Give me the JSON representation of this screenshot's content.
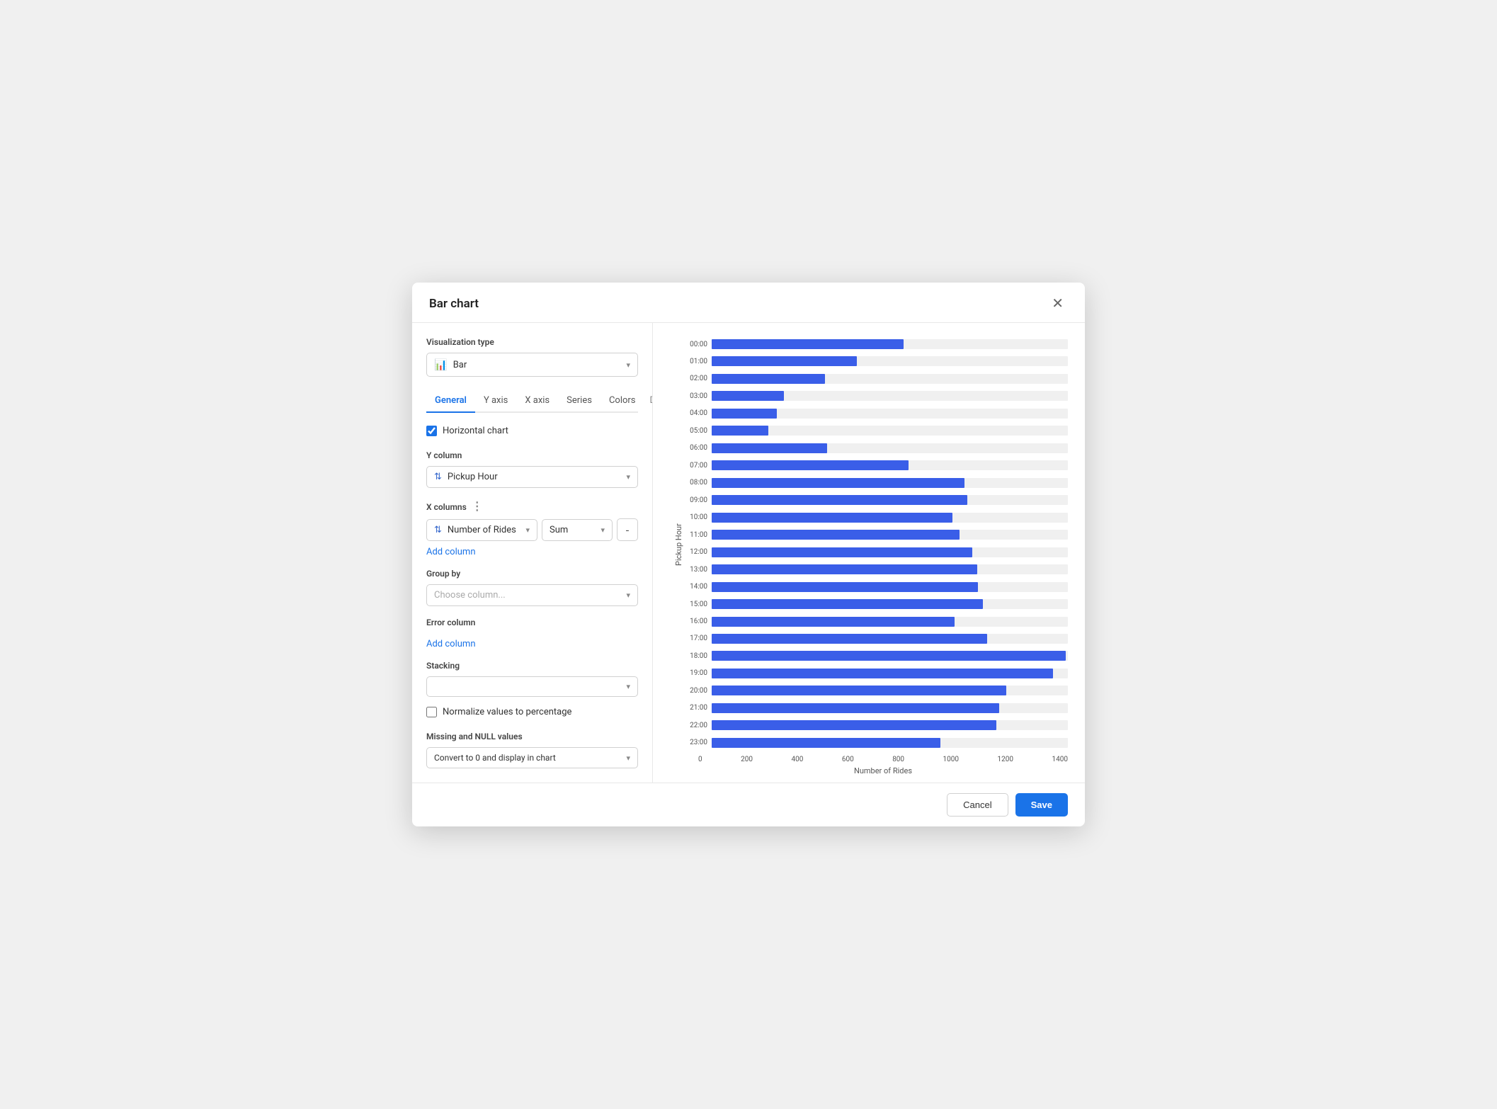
{
  "modal": {
    "title": "Bar chart",
    "close_label": "✕"
  },
  "left": {
    "viz_type_label": "Visualization type",
    "viz_options": [
      "Bar"
    ],
    "viz_selected": "Bar",
    "tabs": [
      {
        "label": "General",
        "active": true
      },
      {
        "label": "Y axis",
        "active": false
      },
      {
        "label": "X axis",
        "active": false
      },
      {
        "label": "Series",
        "active": false
      },
      {
        "label": "Colors",
        "active": false
      },
      {
        "label": "Dat",
        "active": false
      }
    ],
    "horizontal_chart_label": "Horizontal chart",
    "horizontal_chart_checked": true,
    "y_column_label": "Y column",
    "y_column_value": "Pickup Hour",
    "x_columns_label": "X columns",
    "x_column_value": "Number of Rides",
    "x_agg_value": "Sum",
    "add_column_label": "Add column",
    "group_by_label": "Group by",
    "group_by_placeholder": "Choose column...",
    "error_column_label": "Error column",
    "error_add_column_label": "Add column",
    "stacking_label": "Stacking",
    "normalize_label": "Normalize values to percentage",
    "null_values_label": "Missing and NULL values",
    "null_values_value": "Convert to 0 and display in chart"
  },
  "chart": {
    "y_axis_label": "Pickup Hour",
    "x_axis_label": "Number of Rides",
    "x_ticks": [
      "0",
      "200",
      "400",
      "600",
      "800",
      "1000",
      "1200",
      "1400"
    ],
    "max_value": 1450,
    "bars": [
      {
        "time": "00:00",
        "value": 780
      },
      {
        "time": "01:00",
        "value": 590
      },
      {
        "time": "02:00",
        "value": 460
      },
      {
        "time": "03:00",
        "value": 295
      },
      {
        "time": "04:00",
        "value": 265
      },
      {
        "time": "05:00",
        "value": 230
      },
      {
        "time": "06:00",
        "value": 470
      },
      {
        "time": "07:00",
        "value": 800
      },
      {
        "time": "08:00",
        "value": 1030
      },
      {
        "time": "09:00",
        "value": 1040
      },
      {
        "time": "10:00",
        "value": 980
      },
      {
        "time": "11:00",
        "value": 1010
      },
      {
        "time": "12:00",
        "value": 1060
      },
      {
        "time": "13:00",
        "value": 1080
      },
      {
        "time": "14:00",
        "value": 1085
      },
      {
        "time": "15:00",
        "value": 1105
      },
      {
        "time": "16:00",
        "value": 990
      },
      {
        "time": "17:00",
        "value": 1120
      },
      {
        "time": "18:00",
        "value": 1440
      },
      {
        "time": "19:00",
        "value": 1390
      },
      {
        "time": "20:00",
        "value": 1200
      },
      {
        "time": "21:00",
        "value": 1170
      },
      {
        "time": "22:00",
        "value": 1160
      },
      {
        "time": "23:00",
        "value": 930
      }
    ]
  },
  "footer": {
    "cancel_label": "Cancel",
    "save_label": "Save"
  }
}
